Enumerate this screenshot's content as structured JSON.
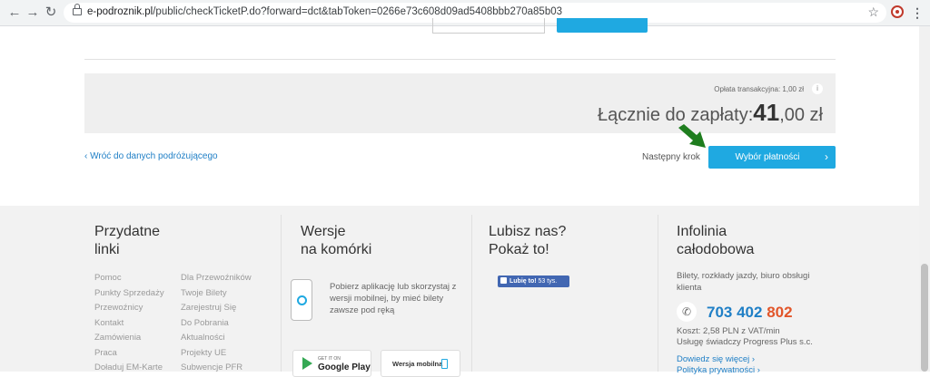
{
  "browser": {
    "back_icon": "←",
    "forward_icon": "→",
    "reload_icon": "↻",
    "url_host": "e-podroznik.pl",
    "url_path": "/public/checkTicketP.do?forward=dct&tabToken=0266e73c608d09ad5408bbb270a85b03",
    "star_icon": "☆",
    "menu_icon": "⋮"
  },
  "summary": {
    "fee_label": "Opłata transakcyjna: 1,00 zł",
    "info_icon": "i",
    "total_label": "Łącznie do zapłaty:",
    "total_main": "41",
    "total_rest": ",00 zł"
  },
  "navigation": {
    "back_chevron": "‹",
    "back_link": "Wróć do danych podróżującego",
    "next_label": "Następny krok",
    "pay_button": "Wybór płatności",
    "pay_chevron": "›",
    "arrow_color": "#1e7d1e"
  },
  "footer": {
    "useful": {
      "title_line1": "Przydatne",
      "title_line2": "linki",
      "col1": [
        "Pomoc",
        "Punkty Sprzedaży",
        "Przewoźnicy",
        "Kontakt",
        "Zamówienia",
        "Praca",
        "Doładuj EM-Karte"
      ],
      "col2": [
        "Dla Przewoźników",
        "Twoje Bilety",
        "Zarejestruj Się",
        "Do Pobrania",
        "Aktualności",
        "Projekty UE",
        "Subwencje PFR"
      ]
    },
    "mobile": {
      "title_line1": "Wersje",
      "title_line2": "na komórki",
      "app_text": "Pobierz aplikację lub skorzystaj z wersji mobilnej, by mieć bilety zawsze pod ręką",
      "store_small": "GET IT ON",
      "store_big": "Google Play",
      "mobile_button": "Wersja mobilna"
    },
    "like": {
      "title_line1": "Lubisz nas?",
      "title_line2": "Pokaż to!",
      "fb_label": "Lubię to!",
      "fb_count": "53 tys."
    },
    "hotline": {
      "title_line1": "Infolinia",
      "title_line2": "całodobowa",
      "description": "Bilety, rozkłady jazdy, biuro obsługi klienta",
      "phone_icon": "✆",
      "phone_part1": "703 402",
      "phone_part2": "802",
      "cost_line1": "Koszt: 2,58 PLN z VAT/min",
      "cost_line2": "Usługę świadczy Progress Plus s.c.",
      "more_link": "Dowiedz się więcej ›",
      "privacy_link": "Polityka prywatności ›"
    }
  },
  "colors": {
    "accent_blue": "#1fa9e1",
    "link_blue": "#1f7fc6",
    "phone_red": "#e2562a"
  }
}
